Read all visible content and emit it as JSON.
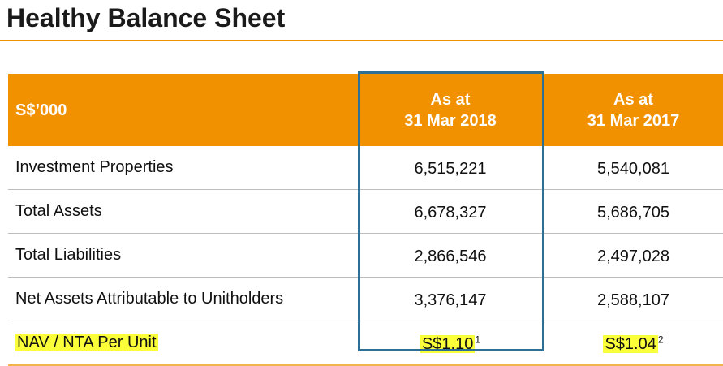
{
  "title": "Healthy Balance Sheet",
  "colors": {
    "accent": "#f29100",
    "highlight_frame": "#2e6f95",
    "marker": "#fbff3a"
  },
  "table": {
    "header_label": "S$’000",
    "columns": [
      {
        "line1": "As at",
        "line2": "31 Mar 2018"
      },
      {
        "line1": "As at",
        "line2": "31 Mar 2017"
      }
    ],
    "rows": [
      {
        "label": "Investment Properties",
        "v2018": "6,515,221",
        "v2017": "5,540,081"
      },
      {
        "label": "Total Assets",
        "v2018": "6,678,327",
        "v2017": "5,686,705"
      },
      {
        "label": "Total Liabilities",
        "v2018": "2,866,546",
        "v2017": "2,497,028"
      },
      {
        "label": "Net Assets Attributable to Unitholders",
        "v2018": "3,376,147",
        "v2017": "2,588,107"
      }
    ],
    "nav_row": {
      "label": "NAV / NTA Per Unit",
      "v2018": "S$1.10",
      "v2018_note": "1",
      "v2017": "S$1.04",
      "v2017_note": "2"
    }
  }
}
